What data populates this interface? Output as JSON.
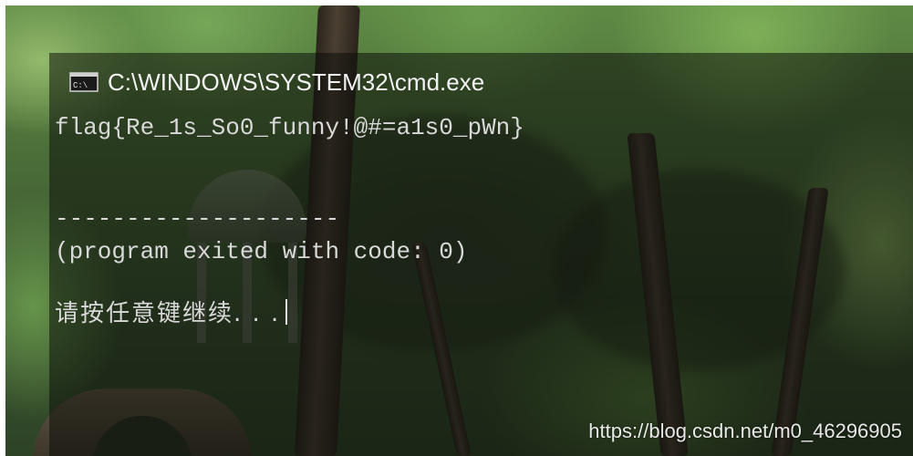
{
  "window": {
    "title": "C:\\WINDOWS\\SYSTEM32\\cmd.exe",
    "icon": "cmd-icon"
  },
  "console": {
    "flag_line": "flag{Re_1s_So0_funny!@#=a1s0_pWn}",
    "divider_line": "--------------------",
    "exit_line": "(program exited with code: 0)",
    "prompt_line": "请按任意键继续. . ."
  },
  "watermark": {
    "text": "https://blog.csdn.net/m0_46296905"
  },
  "colors": {
    "console_text": "#d8d8d8",
    "title_text": "#f2f2f2"
  }
}
